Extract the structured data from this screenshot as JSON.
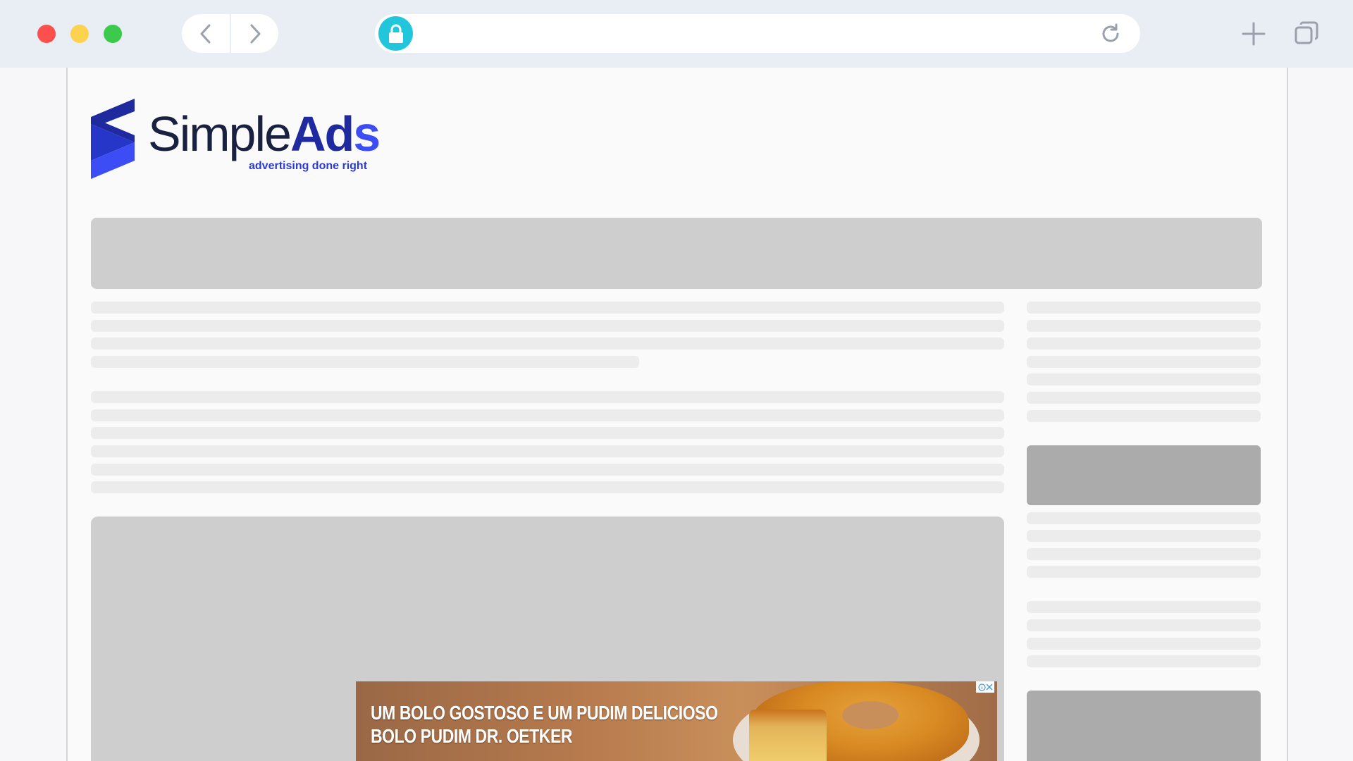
{
  "browser": {
    "url": "",
    "traffic_lights": [
      "close",
      "minimize",
      "zoom"
    ]
  },
  "site": {
    "logo_text_simple": "Simple",
    "logo_text_ads_a": "Ad",
    "logo_text_ads_s": "s",
    "tagline": "advertising done right"
  },
  "ad": {
    "line1": "UM BOLO GOSTOSO E UM PUDIM DELICIOSO",
    "line2": "BOLO PUDIM DR. OETKER",
    "choices_icon": "adchoices-icon"
  },
  "colors": {
    "accent_lock": "#21c6dc",
    "brand_dark": "#1e2a9e",
    "brand_light": "#3d4df5"
  }
}
